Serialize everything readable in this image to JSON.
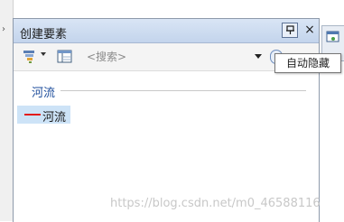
{
  "window": {
    "title": "创建要素",
    "pin_icon": "pin-icon",
    "close_label": "×"
  },
  "toolbar": {
    "organize_icon": "organize-templates-icon",
    "view_icon": "view-icon",
    "search_placeholder": "<搜索>",
    "search_go_icon": "search-go-icon"
  },
  "tooltip": {
    "text": "自动隐藏"
  },
  "templates": {
    "group_header": "河流",
    "items": [
      {
        "label": "河流",
        "symbol_color": "#e21b1b"
      }
    ]
  },
  "watermark": {
    "text": "https://blog.csdn.net/m0_46588116"
  },
  "colors": {
    "title_bar": "#c9d8ee",
    "selection": "#cde3f7",
    "group_header_text": "#1f4e9c"
  }
}
